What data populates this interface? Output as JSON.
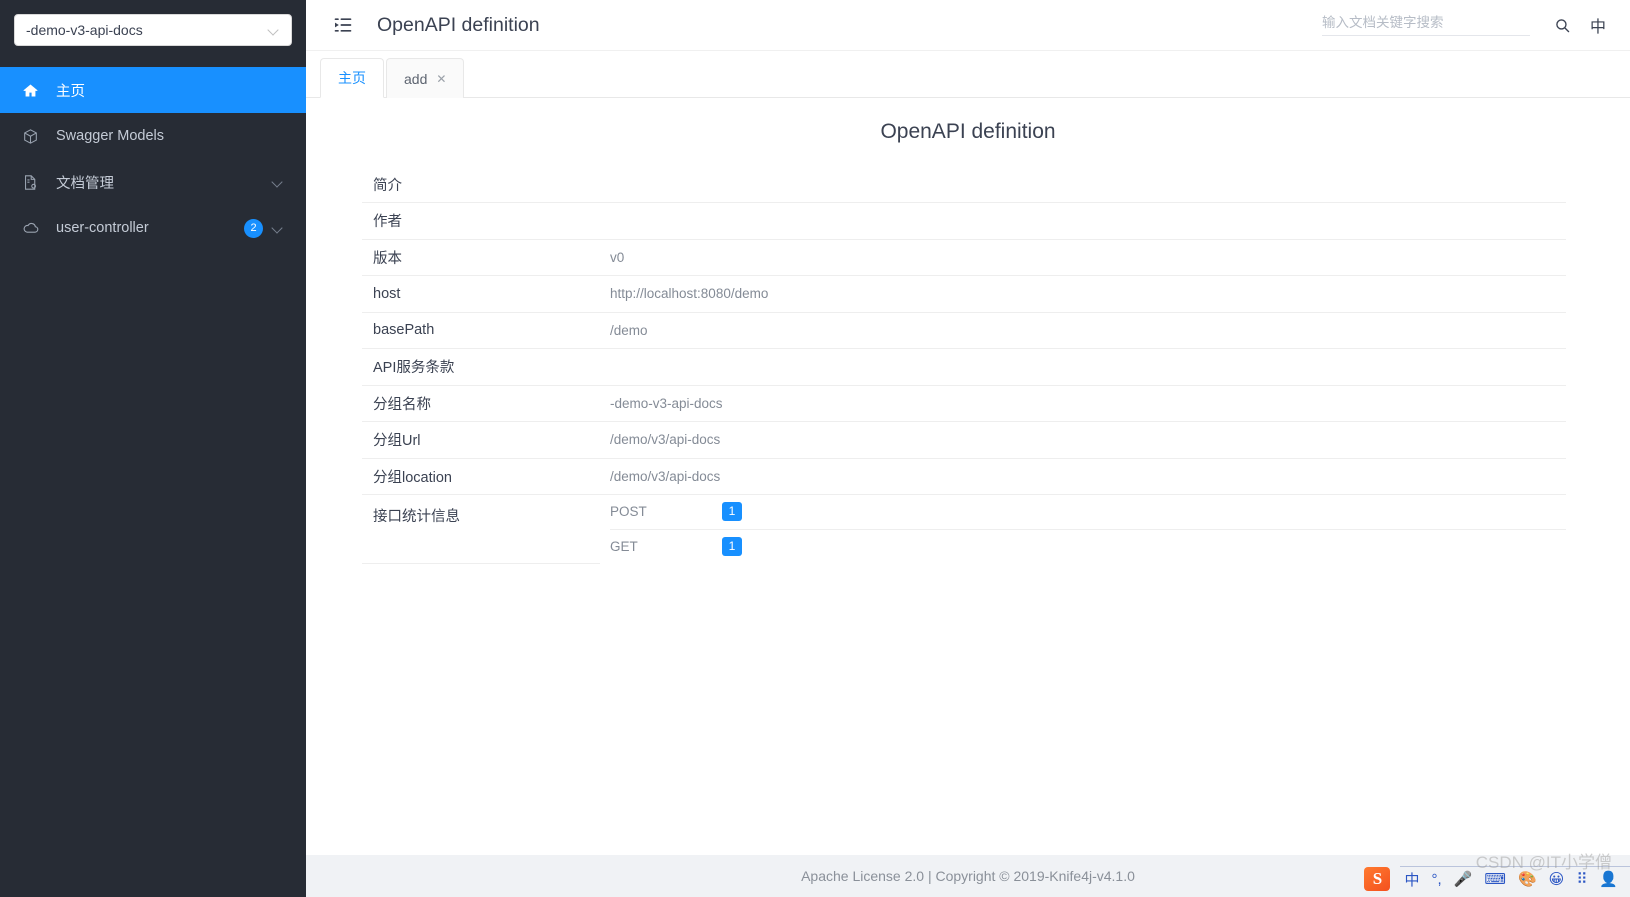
{
  "sidebar": {
    "group_select": {
      "value": "-demo-v3-api-docs",
      "icon": "chevron-down-icon"
    },
    "items": [
      {
        "label": "主页",
        "icon": "home-icon",
        "active": true,
        "badge": "",
        "expandable": false
      },
      {
        "label": "Swagger Models",
        "icon": "cube-icon",
        "active": false,
        "badge": "",
        "expandable": false
      },
      {
        "label": "文档管理",
        "icon": "document-settings-icon",
        "active": false,
        "badge": "",
        "expandable": true
      },
      {
        "label": "user-controller",
        "icon": "cloud-icon",
        "active": false,
        "badge": "2",
        "expandable": true
      }
    ]
  },
  "topbar": {
    "fold_icon": "menu-fold-icon",
    "title": "OpenAPI definition",
    "search": {
      "placeholder": "输入文档关键字搜索",
      "value": "",
      "icon": "search-icon"
    },
    "lang_button": "中"
  },
  "tabs": [
    {
      "label": "主页",
      "active": true,
      "closable": false
    },
    {
      "label": "add",
      "active": false,
      "closable": true,
      "close_glyph": "✕"
    }
  ],
  "content": {
    "doc_title": "OpenAPI definition",
    "rows": [
      {
        "key": "简介",
        "value": ""
      },
      {
        "key": "作者",
        "value": ""
      },
      {
        "key": "版本",
        "value": "v0"
      },
      {
        "key": "host",
        "value": "http://localhost:8080/demo"
      },
      {
        "key": "basePath",
        "value": "/demo"
      },
      {
        "key": "API服务条款",
        "value": ""
      },
      {
        "key": "分组名称",
        "value": "-demo-v3-api-docs"
      },
      {
        "key": "分组Url",
        "value": "/demo/v3/api-docs"
      },
      {
        "key": "分组location",
        "value": "/demo/v3/api-docs"
      }
    ],
    "stats_row": {
      "key": "接口统计信息",
      "stats": [
        {
          "method": "POST",
          "count": "1"
        },
        {
          "method": "GET",
          "count": "1"
        }
      ]
    }
  },
  "footer": {
    "text": "Apache License 2.0 | Copyright © 2019-Knife4j-v4.1.0"
  },
  "overlay": {
    "watermark": "CSDN @IT小学僧",
    "ime": {
      "logo": "S",
      "items": [
        {
          "glyph": "中",
          "name": "ime-chinese-mode"
        },
        {
          "glyph": "°,",
          "name": "ime-punctuation"
        },
        {
          "glyph": "🎤",
          "name": "ime-voice-input"
        },
        {
          "glyph": "⌨",
          "name": "ime-soft-keyboard"
        },
        {
          "glyph": "🎨",
          "name": "ime-skin"
        },
        {
          "glyph": "😀",
          "name": "ime-emoji"
        },
        {
          "glyph": "⠿",
          "name": "ime-toolbox"
        },
        {
          "glyph": "👤",
          "name": "ime-account"
        }
      ]
    }
  },
  "colors": {
    "sidebar_bg": "#272c35",
    "accent": "#1890ff",
    "footer_bg": "#f0f2f5",
    "text_primary": "#3b4252",
    "text_muted": "#848b96"
  }
}
